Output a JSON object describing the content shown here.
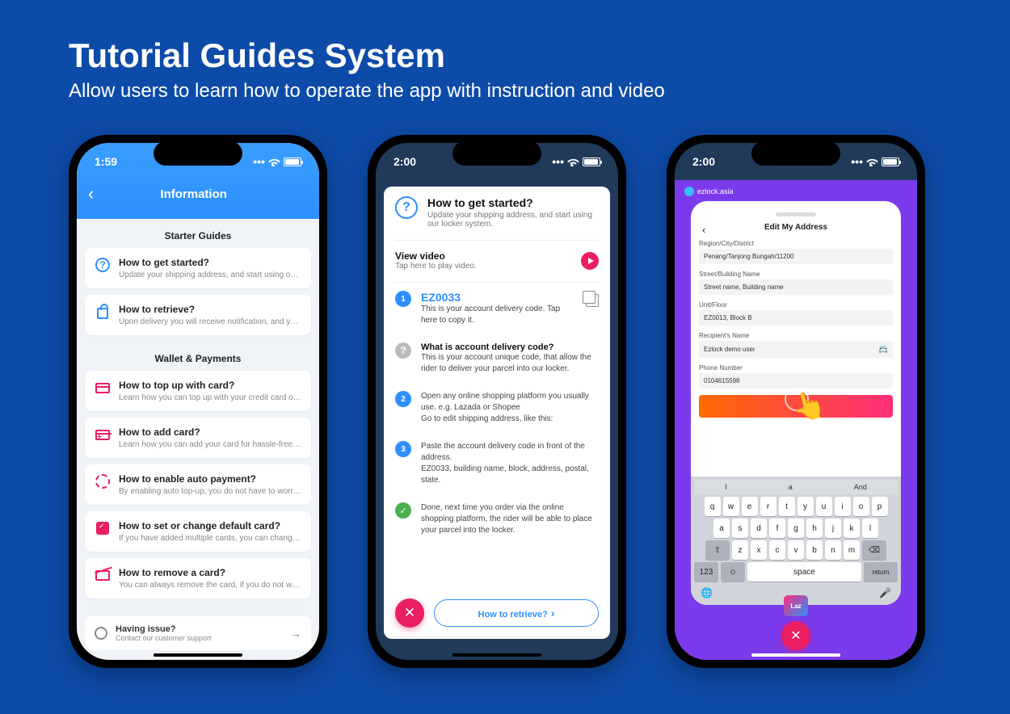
{
  "header": {
    "title": "Tutorial Guides System",
    "subtitle": "Allow users to learn how to operate the app with instruction and video"
  },
  "p1": {
    "time": "1:59",
    "nav_title": "Information",
    "section_a": "Starter Guides",
    "items_a": [
      {
        "title": "How to get started?",
        "desc": "Update your shipping address, and start using our l..."
      },
      {
        "title": "How to retrieve?",
        "desc": "Upon delivery you will receive notification, and you ..."
      }
    ],
    "section_b": "Wallet & Payments",
    "items_b": [
      {
        "title": "How to top up with card?",
        "desc": "Learn how you can top up with your credit card or d..."
      },
      {
        "title": "How to add card?",
        "desc": "Learn how you can add your card for hassle-free to..."
      },
      {
        "title": "How to enable auto payment?",
        "desc": "By enabling auto top-up, you do not have to worry a..."
      },
      {
        "title": "How to set or change default card?",
        "desc": "If you have added multiple cards, you can change y..."
      },
      {
        "title": "How to remove a card?",
        "desc": "You can always remove the card, if you do not wish ..."
      }
    ],
    "footer": {
      "title": "Having issue?",
      "desc": "Contact our customer support"
    }
  },
  "p2": {
    "time": "2:00",
    "top": {
      "title": "How to get started?",
      "desc": "Update your shipping address, and start using our locker system."
    },
    "video": {
      "title": "View video",
      "desc": "Tap here to play video."
    },
    "code": {
      "value": "EZ0033",
      "desc": "This is your account delivery code. Tap here to copy it."
    },
    "what": {
      "title": "What is account delivery code?",
      "desc": "This is your account unique code, that allow the rider to deliver your parcel into our locker."
    },
    "step2": "Open any online shopping platform you usually use. e.g. Lazada or Shopee\nGo to edit shipping address, like this:",
    "step3": "Paste the account delivery code in front of the address.\nEZ0033, building name, block, address, postal, state.",
    "done": "Done, next time you order via the online shopping platform, the rider will be able to place your parcel into the locker.",
    "next": "How to retrieve?"
  },
  "p3": {
    "time": "2:00",
    "brand": "ezlock.asia",
    "inner_title": "Edit My Address",
    "form": {
      "region_label": "Region/City/District",
      "region_value": "Penang/Tanjong Bungah/11200",
      "street_label": "Street/Building Name",
      "street_value": "Street name, Building name",
      "unit_label": "Unit/Floor",
      "unit_value": "EZ0013, Block B",
      "name_label": "Recipient's Name",
      "name_value": "Ezlock demo user",
      "phone_label": "Phone Number",
      "phone_value": "0104615598"
    },
    "suggest": [
      "I",
      "a",
      "And"
    ],
    "kb_r1": [
      "q",
      "w",
      "e",
      "r",
      "t",
      "y",
      "u",
      "i",
      "o",
      "p"
    ],
    "kb_r2": [
      "a",
      "s",
      "d",
      "f",
      "g",
      "h",
      "j",
      "k",
      "l"
    ],
    "kb_r3": [
      "z",
      "x",
      "c",
      "v",
      "b",
      "n",
      "m"
    ],
    "kb_123": "123",
    "kb_space": "space",
    "kb_return": "return",
    "laz": "Laz"
  }
}
